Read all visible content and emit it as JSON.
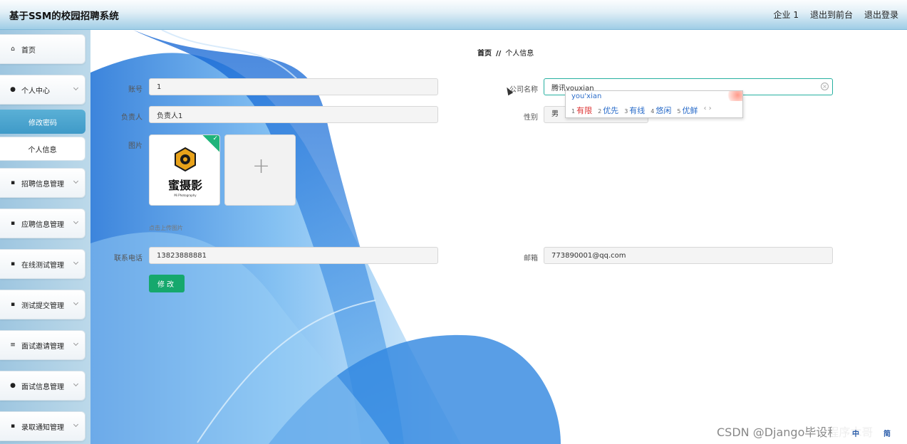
{
  "header": {
    "title": "基于SSM的校园招聘系统",
    "links": [
      "企业 1",
      "退出到前台",
      "退出登录"
    ]
  },
  "sidebar": {
    "items": [
      {
        "label": "首页",
        "icon": "home-icon",
        "glyph": "⌂"
      },
      {
        "label": "个人中心",
        "icon": "user-icon",
        "glyph": "●"
      },
      {
        "label": "招聘信息管理",
        "icon": "grid-icon",
        "glyph": "▪"
      },
      {
        "label": "应聘信息管理",
        "icon": "grid-icon",
        "glyph": "▪"
      },
      {
        "label": "在线测试管理",
        "icon": "grid-icon",
        "glyph": "▪"
      },
      {
        "label": "测试提交管理",
        "icon": "thumb-icon",
        "glyph": "▪"
      },
      {
        "label": "面试邀请管理",
        "icon": "list-icon",
        "glyph": "≡"
      },
      {
        "label": "面试信息管理",
        "icon": "user-icon",
        "glyph": "●"
      },
      {
        "label": "录取通知管理",
        "icon": "grid-icon",
        "glyph": "▪"
      }
    ],
    "sub_items": [
      "修改密码",
      "个人信息"
    ]
  },
  "breadcrumb": {
    "home": "首页",
    "separator": "//",
    "current": "个人信息"
  },
  "form": {
    "account": {
      "label": "账号",
      "value": "1"
    },
    "company": {
      "label": "公司名称",
      "value": "腾讯youxian"
    },
    "manager": {
      "label": "负责人",
      "value": "负责人1"
    },
    "gender": {
      "label": "性别",
      "value": "男"
    },
    "picture": {
      "label": "图片",
      "hint": "点击上传图片",
      "plus": "+",
      "check": "✓"
    },
    "phone": {
      "label": "联系电话",
      "value": "13823888881"
    },
    "email": {
      "label": "邮箱",
      "value": "773890001@qq.com"
    },
    "submit_label": "修改"
  },
  "ime": {
    "pinyin": "you'xian",
    "candidates": [
      {
        "num": "1",
        "text": "有限"
      },
      {
        "num": "2",
        "text": "优先"
      },
      {
        "num": "3",
        "text": "有线"
      },
      {
        "num": "4",
        "text": "悠闲"
      },
      {
        "num": "5",
        "text": "优鲜"
      }
    ],
    "nav": "‹ ›"
  },
  "logo": {
    "text": "蜜摄影",
    "subtext": "Mi Photography"
  },
  "watermark": "CSDN @Django毕设程序木哥",
  "tray": {
    "text": "中",
    "extra": "简"
  },
  "colors": {
    "accent": "#3f9ac8",
    "submit": "#16a86d",
    "focus_border": "#27b0a0",
    "ime_blue": "#2a6cc9"
  }
}
